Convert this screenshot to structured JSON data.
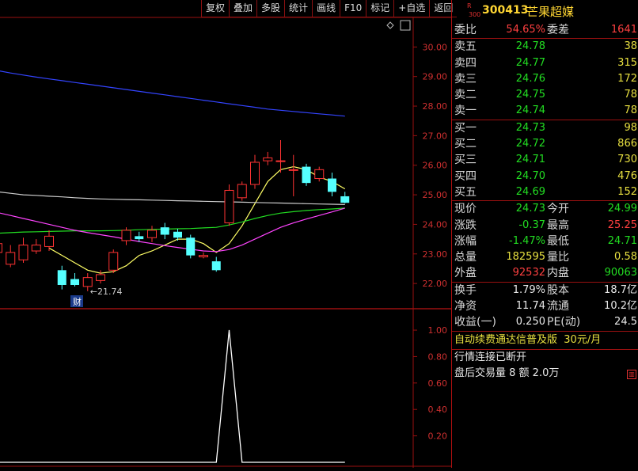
{
  "toolbar": {
    "buttons": [
      "复权",
      "叠加",
      "多股",
      "统计",
      "画线",
      "F10",
      "标记",
      "+自选",
      "返回"
    ]
  },
  "main_chart": {
    "y_ticks": [
      "30.00",
      "29.00",
      "28.00",
      "27.00",
      "26.00",
      "25.00",
      "24.00",
      "23.00",
      "22.00"
    ],
    "annotation_low": "←21.74",
    "finance_marker": "财"
  },
  "sub_chart": {
    "y_ticks": [
      "1.00",
      "0.80",
      "0.60",
      "0.40",
      "0.20"
    ]
  },
  "chart_data": [
    {
      "type": "candlestick",
      "ylim": [
        21.2,
        31.0
      ],
      "candles": [
        {
          "o": 23.05,
          "c": 23.35,
          "h": 23.6,
          "l": 22.8
        },
        {
          "o": 22.65,
          "c": 23.05,
          "h": 23.3,
          "l": 22.55
        },
        {
          "o": 22.8,
          "c": 23.3,
          "h": 23.55,
          "l": 22.7
        },
        {
          "o": 23.1,
          "c": 23.3,
          "h": 23.5,
          "l": 23.0
        },
        {
          "o": 23.25,
          "c": 23.6,
          "h": 23.8,
          "l": 23.1
        },
        {
          "o": 22.45,
          "c": 21.95,
          "h": 22.6,
          "l": 21.8
        },
        {
          "o": 22.15,
          "c": 21.95,
          "h": 22.35,
          "l": 21.9
        },
        {
          "o": 21.9,
          "c": 22.2,
          "h": 22.35,
          "l": 21.74
        },
        {
          "o": 22.1,
          "c": 22.3,
          "h": 22.45,
          "l": 22.0
        },
        {
          "o": 22.45,
          "c": 23.05,
          "h": 23.15,
          "l": 22.35
        },
        {
          "o": 23.45,
          "c": 23.8,
          "h": 23.9,
          "l": 23.3
        },
        {
          "o": 23.6,
          "c": 23.5,
          "h": 23.75,
          "l": 23.4
        },
        {
          "o": 23.55,
          "c": 23.8,
          "h": 23.95,
          "l": 23.4
        },
        {
          "o": 23.9,
          "c": 23.65,
          "h": 24.05,
          "l": 23.5
        },
        {
          "o": 23.75,
          "c": 23.55,
          "h": 23.85,
          "l": 23.45
        },
        {
          "o": 23.55,
          "c": 22.95,
          "h": 23.65,
          "l": 22.85
        },
        {
          "o": 22.9,
          "c": 22.95,
          "h": 23.05,
          "l": 22.85
        },
        {
          "o": 22.75,
          "c": 22.45,
          "h": 22.9,
          "l": 22.4
        },
        {
          "o": 24.05,
          "c": 25.15,
          "h": 25.35,
          "l": 23.95
        },
        {
          "o": 24.9,
          "c": 25.35,
          "h": 25.45,
          "l": 24.8
        },
        {
          "o": 25.35,
          "c": 26.1,
          "h": 26.35,
          "l": 25.2
        },
        {
          "o": 26.15,
          "c": 26.25,
          "h": 26.45,
          "l": 26.0
        },
        {
          "o": 26.15,
          "c": 26.15,
          "h": 26.85,
          "l": 25.75
        },
        {
          "o": 25.85,
          "c": 25.85,
          "h": 26.35,
          "l": 24.95
        },
        {
          "o": 25.95,
          "c": 25.4,
          "h": 26.05,
          "l": 25.3
        },
        {
          "o": 25.55,
          "c": 25.85,
          "h": 25.95,
          "l": 25.45
        },
        {
          "o": 25.55,
          "c": 25.1,
          "h": 25.75,
          "l": 24.95
        },
        {
          "o": 24.95,
          "c": 24.73,
          "h": 25.1,
          "l": 24.71
        }
      ],
      "ma_lines": [
        {
          "color": "#ffff66",
          "values": [
            null,
            null,
            null,
            null,
            23.2,
            22.95,
            22.7,
            22.45,
            22.35,
            22.4,
            22.6,
            22.95,
            23.1,
            23.3,
            23.5,
            23.5,
            23.35,
            23.05,
            23.35,
            23.95,
            24.7,
            25.45,
            25.85,
            25.95,
            25.85,
            25.6,
            25.45,
            25.2
          ]
        },
        {
          "color": "#cccccc",
          "values": [
            25.1,
            25.05,
            25.0,
            24.98,
            24.95,
            24.93,
            24.9,
            24.88,
            24.86,
            24.85,
            24.84,
            24.83,
            24.82,
            24.81,
            24.8,
            24.79,
            24.78,
            24.77,
            24.76,
            24.75,
            24.74,
            24.73,
            24.72,
            24.71,
            24.7,
            24.69,
            24.68,
            24.67
          ]
        },
        {
          "color": "#22dd22",
          "values": [
            23.7,
            23.72,
            23.74,
            23.75,
            23.76,
            23.77,
            23.78,
            23.78,
            23.78,
            23.79,
            23.8,
            23.82,
            23.83,
            23.84,
            23.85,
            23.86,
            23.88,
            23.9,
            23.98,
            24.08,
            24.2,
            24.3,
            24.38,
            24.43,
            24.47,
            24.5,
            24.52,
            24.55
          ]
        },
        {
          "color": "#ff44ff",
          "values": [
            24.4,
            24.3,
            24.2,
            24.1,
            24.0,
            23.9,
            23.8,
            23.72,
            23.65,
            23.58,
            23.5,
            23.42,
            23.35,
            23.28,
            23.22,
            23.16,
            23.1,
            23.08,
            23.15,
            23.3,
            23.5,
            23.7,
            23.9,
            24.05,
            24.18,
            24.3,
            24.42,
            24.55
          ]
        },
        {
          "color": "#3344ff",
          "values": [
            29.2,
            29.12,
            29.05,
            28.98,
            28.92,
            28.86,
            28.8,
            28.74,
            28.68,
            28.62,
            28.56,
            28.5,
            28.44,
            28.38,
            28.32,
            28.26,
            28.2,
            28.14,
            28.08,
            28.02,
            27.96,
            27.9,
            27.86,
            27.82,
            27.78,
            27.74,
            27.7,
            27.66
          ]
        }
      ]
    },
    {
      "type": "line",
      "ylim": [
        0,
        1.15
      ],
      "values": [
        0,
        0,
        0,
        0,
        0,
        0,
        0,
        0,
        0,
        0,
        0,
        0,
        0,
        0,
        0,
        0,
        0,
        0,
        1,
        0,
        0,
        0,
        0,
        0,
        0,
        0,
        0,
        0
      ]
    }
  ],
  "quote": {
    "code": "300413",
    "name": "芒果超媒",
    "ratio_label": "委比",
    "ratio_value": "54.65%",
    "diff_label": "委差",
    "diff_value": "1641",
    "asks": [
      {
        "label": "卖五",
        "price": "24.78",
        "vol": "38"
      },
      {
        "label": "卖四",
        "price": "24.77",
        "vol": "315"
      },
      {
        "label": "卖三",
        "price": "24.76",
        "vol": "172"
      },
      {
        "label": "卖二",
        "price": "24.75",
        "vol": "78"
      },
      {
        "label": "卖一",
        "price": "24.74",
        "vol": "78"
      }
    ],
    "bids": [
      {
        "label": "买一",
        "price": "24.73",
        "vol": "98"
      },
      {
        "label": "买二",
        "price": "24.72",
        "vol": "866"
      },
      {
        "label": "买三",
        "price": "24.71",
        "vol": "730"
      },
      {
        "label": "买四",
        "price": "24.70",
        "vol": "476"
      },
      {
        "label": "买五",
        "price": "24.69",
        "vol": "152"
      }
    ],
    "stats": [
      {
        "l1": "现价",
        "v1": "24.73",
        "c1": "green",
        "l2": "今开",
        "v2": "24.99",
        "c2": "green"
      },
      {
        "l1": "涨跌",
        "v1": "-0.37",
        "c1": "green",
        "l2": "最高",
        "v2": "25.25",
        "c2": "red"
      },
      {
        "l1": "涨幅",
        "v1": "-1.47%",
        "c1": "green",
        "l2": "最低",
        "v2": "24.71",
        "c2": "green"
      },
      {
        "l1": "总量",
        "v1": "182595",
        "c1": "yellow",
        "l2": "量比",
        "v2": "0.58",
        "c2": "yellow"
      },
      {
        "l1": "外盘",
        "v1": "92532",
        "c1": "red",
        "l2": "内盘",
        "v2": "90063",
        "c2": "green"
      }
    ],
    "fund": [
      {
        "l1": "换手",
        "v1": "1.79%",
        "l2": "股本",
        "v2": "18.7亿"
      },
      {
        "l1": "净资",
        "v1": "11.74",
        "l2": "流通",
        "v2": "10.2亿"
      },
      {
        "l1": "收益(一)",
        "v1": "0.250",
        "l2": "PE(动)",
        "v2": "24.5"
      }
    ],
    "ad_text": "自动续费通达信普及版",
    "ad_price": "30元/月",
    "status": "行情连接已断开",
    "after_hours": "盘后交易量 8 额 2.0万"
  }
}
